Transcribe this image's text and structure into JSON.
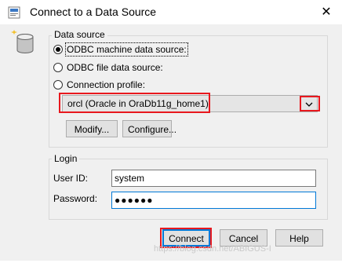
{
  "window": {
    "title": "Connect to a Data Source",
    "close_glyph": "✕"
  },
  "data_source": {
    "group_label": "Data source",
    "options": [
      {
        "label": "ODBC machine data source:",
        "checked": true
      },
      {
        "label": "ODBC file data source:",
        "checked": false
      },
      {
        "label": "Connection profile:",
        "checked": false
      }
    ],
    "profile_value": "orcl (Oracle in OraDb11g_home1)",
    "modify_label": "Modify...",
    "configure_label": "Configure..."
  },
  "login": {
    "group_label": "Login",
    "user_id_label": "User ID:",
    "user_id_value": "system",
    "password_label": "Password:",
    "password_value": "●●●●●●"
  },
  "footer": {
    "connect_label": "Connect",
    "cancel_label": "Cancel",
    "help_label": "Help"
  },
  "watermark": "https://blog.csdn.net/ABIGUS-I",
  "icons": {
    "title": "data-source-icon",
    "dialog": "database-icon",
    "dropdown": "chevron-down-icon"
  },
  "colors": {
    "highlight": "#e8181e",
    "focus": "#0078d7"
  }
}
